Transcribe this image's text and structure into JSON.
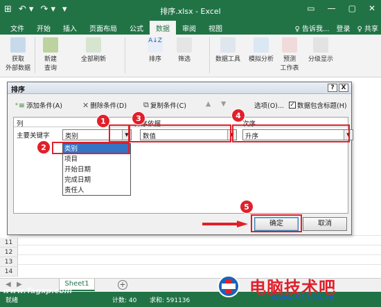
{
  "window": {
    "title": "排序.xlsx - Excel",
    "qat": [
      "⊞",
      "↶ ▾",
      "↷ ▾",
      "▾"
    ],
    "controls": [
      "?",
      "▭",
      "—",
      "▢",
      "✕"
    ]
  },
  "ribbon_tabs": [
    "文件",
    "开始",
    "插入",
    "页面布局",
    "公式",
    "数据",
    "审阅",
    "视图"
  ],
  "ribbon_right": {
    "tell": "♀ 告诉我...",
    "login": "登录",
    "share": "♀ 共享"
  },
  "ribbon_buttons": [
    {
      "label": "获取\n外部数据"
    },
    {
      "label": "新建\n查询"
    },
    {
      "label": "全部刷新"
    },
    {
      "label": "排序"
    },
    {
      "label": "筛选"
    },
    {
      "label": "数据工具"
    },
    {
      "label": "模拟分析"
    },
    {
      "label": "预测\n工作表"
    },
    {
      "label": "分级显示"
    }
  ],
  "rows": [
    "11",
    "12",
    "13",
    "14"
  ],
  "dialog": {
    "title": "排序",
    "help": "?",
    "close": "X",
    "toolbar": {
      "add": "添加条件(A)",
      "delete": "删除条件(D)",
      "copy": "复制条件(C)",
      "up": "▲",
      "down": "▼",
      "options": "选项(O)...",
      "header_checkbox": "数据包含标题(H)"
    },
    "headers": {
      "column": "列",
      "sort_on": "排序依据",
      "order": "次序"
    },
    "row_label": "主要关键字",
    "key_value": "类别",
    "sort_on_value": "数值",
    "order_value": "升序",
    "dropdown_items": [
      "类别",
      "项目",
      "开始日期",
      "完成日期",
      "责任人"
    ],
    "ok": "确定",
    "cancel": "取消"
  },
  "annotations": [
    "1",
    "2",
    "3",
    "4",
    "5"
  ],
  "sheet_tab": "Sheet1",
  "add_sheet": "+",
  "status": {
    "mode": "就绪",
    "count": "计数: 40",
    "sum": "求和: 591136"
  },
  "watermark": {
    "left": "www.Tagxp.com",
    "right": "电脑技术吧",
    "site": "www.51116.cn"
  },
  "colors": {
    "excel_green": "#217346",
    "annotation_red": "#e0202b",
    "selection_blue": "#3574c4"
  }
}
